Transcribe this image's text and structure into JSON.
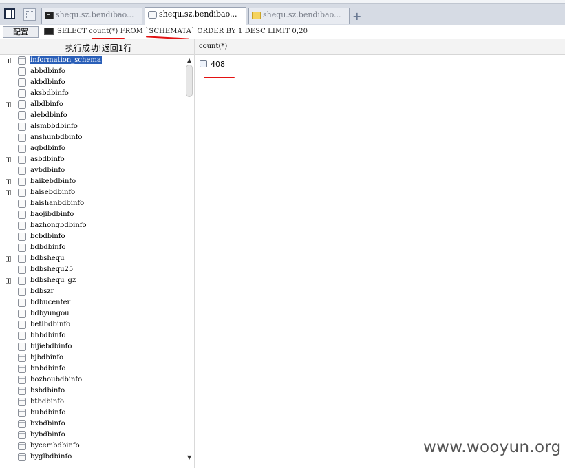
{
  "tabs": [
    {
      "label": "shequ.sz.bendibao...",
      "icon": "terminal-icon",
      "active": false
    },
    {
      "label": "shequ.sz.bendibao...",
      "icon": "database-icon",
      "active": true
    },
    {
      "label": "shequ.sz.bendibao...",
      "icon": "folder-icon",
      "active": false
    }
  ],
  "add_tab_label": "+",
  "toolbar": {
    "config_label": "配置",
    "sql": "SELECT count(*) FROM `SCHEMATA` ORDER BY 1 DESC LIMIT 0,20"
  },
  "status": "执行成功!返回1行",
  "result": {
    "column_header": "count(*)",
    "value": "408"
  },
  "tree": [
    {
      "name": "information_schema",
      "expandable": true,
      "selected": true
    },
    {
      "name": "abbdbinfo",
      "expandable": false
    },
    {
      "name": "akbdbinfo",
      "expandable": false
    },
    {
      "name": "aksbdbinfo",
      "expandable": false
    },
    {
      "name": "albdbinfo",
      "expandable": true
    },
    {
      "name": "alebdbinfo",
      "expandable": false
    },
    {
      "name": "alsmbbdbinfo",
      "expandable": false
    },
    {
      "name": "anshunbdbinfo",
      "expandable": false
    },
    {
      "name": "aqbdbinfo",
      "expandable": false
    },
    {
      "name": "asbdbinfo",
      "expandable": true
    },
    {
      "name": "aybdbinfo",
      "expandable": false
    },
    {
      "name": "baikebdbinfo",
      "expandable": true
    },
    {
      "name": "baisebdbinfo",
      "expandable": true
    },
    {
      "name": "baishanbdbinfo",
      "expandable": false
    },
    {
      "name": "baojibdbinfo",
      "expandable": false
    },
    {
      "name": "bazhongbdbinfo",
      "expandable": false
    },
    {
      "name": "bcbdbinfo",
      "expandable": false
    },
    {
      "name": "bdbdbinfo",
      "expandable": false
    },
    {
      "name": "bdbshequ",
      "expandable": true
    },
    {
      "name": "bdbshequ25",
      "expandable": false
    },
    {
      "name": "bdbshequ_gz",
      "expandable": true
    },
    {
      "name": "bdbszr",
      "expandable": false
    },
    {
      "name": "bdbucenter",
      "expandable": false
    },
    {
      "name": "bdbyungou",
      "expandable": false
    },
    {
      "name": "betlbdbinfo",
      "expandable": false
    },
    {
      "name": "bhbdbinfo",
      "expandable": false
    },
    {
      "name": "bijiebdbinfo",
      "expandable": false
    },
    {
      "name": "bjbdbinfo",
      "expandable": false
    },
    {
      "name": "bnbdbinfo",
      "expandable": false
    },
    {
      "name": "bozhoubdbinfo",
      "expandable": false
    },
    {
      "name": "bsbdbinfo",
      "expandable": false
    },
    {
      "name": "btbdbinfo",
      "expandable": false
    },
    {
      "name": "bubdbinfo",
      "expandable": false
    },
    {
      "name": "bxbdbinfo",
      "expandable": false
    },
    {
      "name": "bybdbinfo",
      "expandable": false
    },
    {
      "name": "bycembdbinfo",
      "expandable": false
    },
    {
      "name": "byglbdbinfo",
      "expandable": false
    }
  ],
  "watermark": "www.wooyun.org",
  "colors": {
    "selection": "#2a5fb8",
    "annotation": "#e31212"
  }
}
